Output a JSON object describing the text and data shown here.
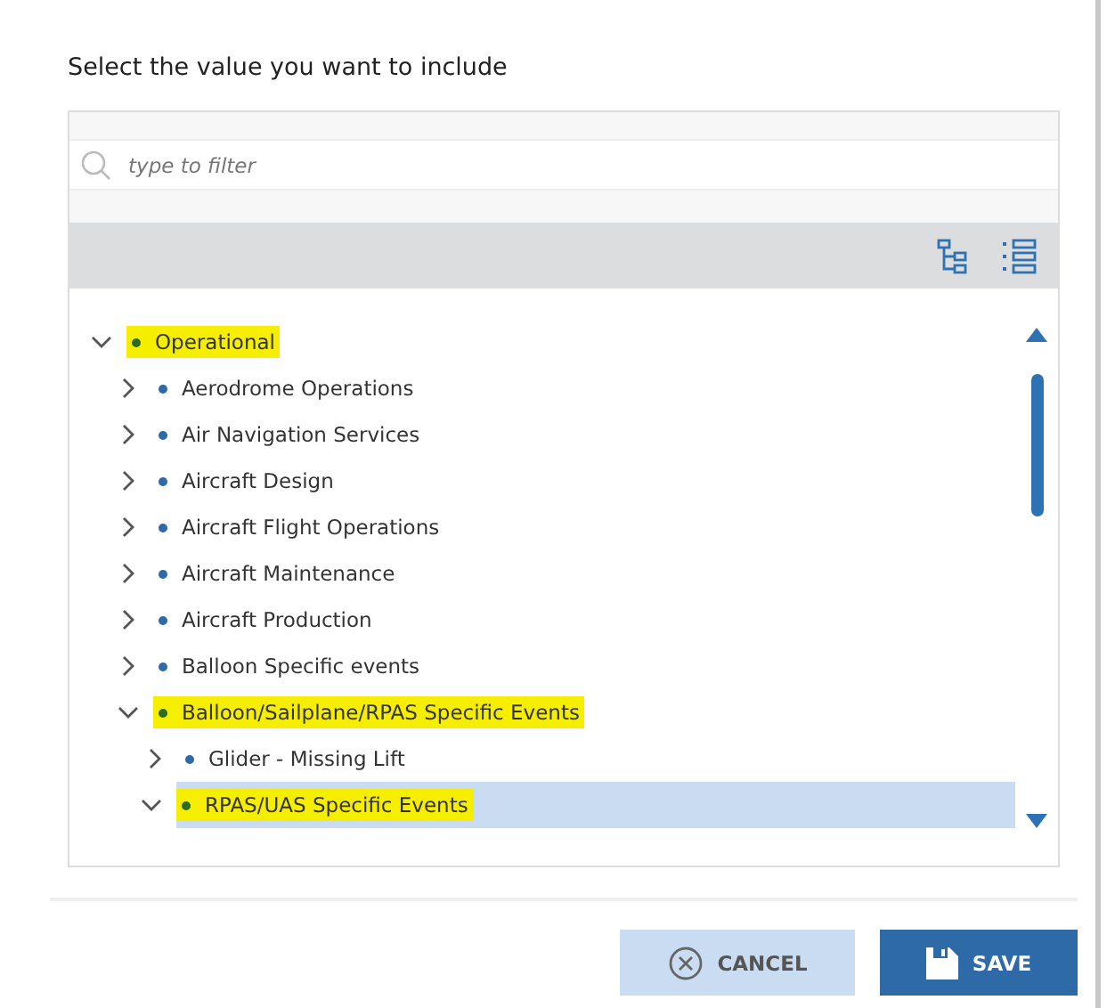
{
  "dialog": {
    "title": "Select the value you want to include"
  },
  "filter": {
    "placeholder": "type to filter"
  },
  "tree": [
    {
      "label": "Operational",
      "expanded": true,
      "highlighted": true,
      "selected": false,
      "children": [
        {
          "label": "Aerodrome Operations",
          "expanded": false,
          "highlighted": false,
          "selected": false
        },
        {
          "label": "Air Navigation Services",
          "expanded": false,
          "highlighted": false,
          "selected": false
        },
        {
          "label": "Aircraft Design",
          "expanded": false,
          "highlighted": false,
          "selected": false
        },
        {
          "label": "Aircraft Flight Operations",
          "expanded": false,
          "highlighted": false,
          "selected": false
        },
        {
          "label": "Aircraft Maintenance",
          "expanded": false,
          "highlighted": false,
          "selected": false
        },
        {
          "label": "Aircraft Production",
          "expanded": false,
          "highlighted": false,
          "selected": false
        },
        {
          "label": "Balloon Specific events",
          "expanded": false,
          "highlighted": false,
          "selected": false
        },
        {
          "label": "Balloon/Sailplane/RPAS Specific Events",
          "expanded": true,
          "highlighted": true,
          "selected": false,
          "children": [
            {
              "label": "Glider - Missing Lift",
              "expanded": false,
              "highlighted": false,
              "selected": false
            },
            {
              "label": "RPAS/UAS Specific Events",
              "expanded": true,
              "highlighted": true,
              "selected": true
            }
          ]
        }
      ]
    }
  ],
  "buttons": [
    {
      "kind": "cancel",
      "label": "CANCEL"
    },
    {
      "kind": "save",
      "label": "SAVE"
    }
  ]
}
